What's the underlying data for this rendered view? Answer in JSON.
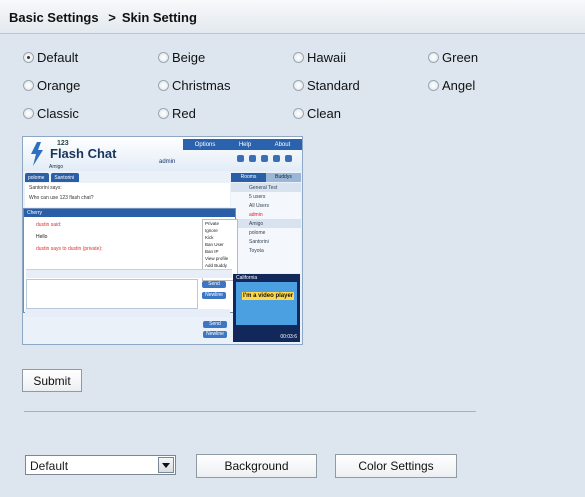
{
  "header": {
    "section": "Basic Settings",
    "separator": ">",
    "page": "Skin Setting"
  },
  "skins": [
    {
      "label": "Default",
      "checked": true
    },
    {
      "label": "Beige",
      "checked": false
    },
    {
      "label": "Hawaii",
      "checked": false
    },
    {
      "label": "Green",
      "checked": false
    },
    {
      "label": "Orange",
      "checked": false
    },
    {
      "label": "Christmas",
      "checked": false
    },
    {
      "label": "Standard",
      "checked": false
    },
    {
      "label": "Angel",
      "checked": false
    },
    {
      "label": "Classic",
      "checked": false
    },
    {
      "label": "Red",
      "checked": false
    },
    {
      "label": "Clean",
      "checked": false
    }
  ],
  "preview": {
    "logo_num": "123",
    "logo_title": "Flash Chat",
    "menu": [
      "Options",
      "Help",
      "About"
    ],
    "current_user": "admin",
    "amigo": "Amigo",
    "tabs": [
      "polome",
      "Santorini"
    ],
    "chat_says": "Santorini says:",
    "chat_message": "Who can use 123 flash chat?",
    "right_tabs": [
      "Rooms",
      "Buddys"
    ],
    "room": "General Test",
    "users_count": "5 users",
    "users": [
      "All Users",
      "admin",
      "Amigo",
      "polome",
      "Santorini",
      "Toyota"
    ],
    "window_title": "Cherry",
    "win_line1": "dustin said:",
    "win_line2": "Hello",
    "win_line3": "dustin says to dustin (private):",
    "context_menu": [
      "Private",
      "Ignore",
      "Kick",
      "Ban User",
      "Ban IP",
      "View profile",
      "Add Buddy"
    ],
    "send_label": "Send",
    "newline_label": "Newline",
    "video_text": "I'm a video player",
    "video_room": "California",
    "video_time": "00:03:6"
  },
  "buttons": {
    "submit": "Submit",
    "background": "Background",
    "color_settings": "Color Settings"
  },
  "skin_select": {
    "value": "Default"
  },
  "colors": {
    "header_text": "#111111",
    "page_bg": "#dde6ee",
    "accent": "#2a5fa8"
  }
}
